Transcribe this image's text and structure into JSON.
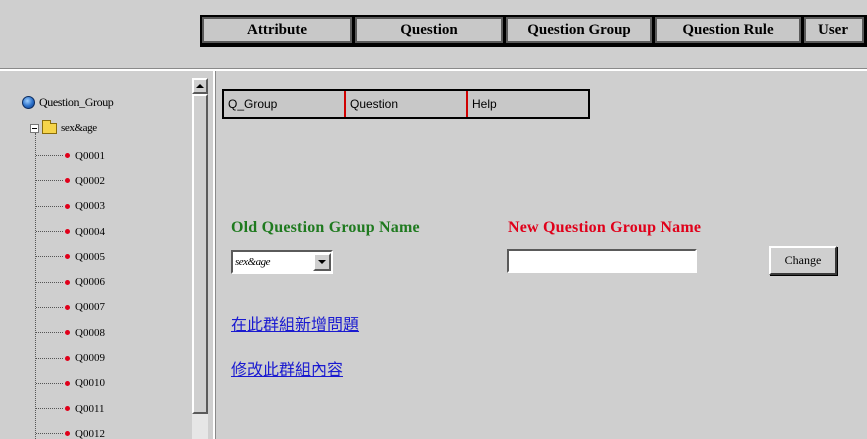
{
  "top_nav": {
    "tabs": [
      "Attribute",
      "Question",
      "Question Group",
      "Question Rule",
      "User"
    ]
  },
  "tree": {
    "root_label": "Question_Group",
    "group_label": "sex&age",
    "items": [
      "Q0001",
      "Q0002",
      "Q0003",
      "Q0004",
      "Q0005",
      "Q0006",
      "Q0007",
      "Q0008",
      "Q0009",
      "Q0010",
      "Q0011",
      "Q0012"
    ]
  },
  "sub_nav": {
    "tabs": [
      "Q_Group",
      "Question",
      "Help"
    ]
  },
  "form": {
    "old_label": "Old Question Group Name",
    "new_label": "New Question Group Name",
    "old_select_value": "sex&age",
    "new_input_value": "",
    "change_button": "Change"
  },
  "links": {
    "add_question": "在此群組新增問題",
    "edit_group": "修改此群組內容"
  },
  "colors": {
    "old_label": "#1f7a1f",
    "new_label": "#e0001a",
    "link": "#1a1ad0",
    "tree_dot": "#e0001a",
    "subnav_divider": "#d00000"
  }
}
